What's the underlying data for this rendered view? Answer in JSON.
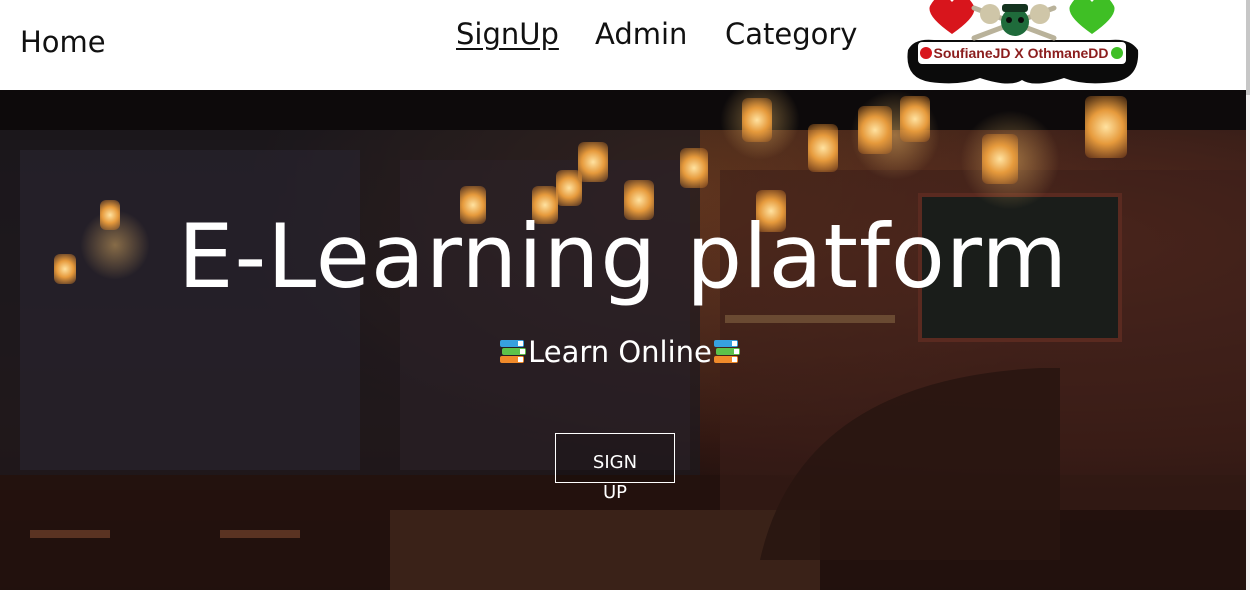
{
  "nav": {
    "home": "Home",
    "signup": "SignUp",
    "admin": "Admin",
    "category": "Category"
  },
  "logo": {
    "text": "SoufianeJD X OthmaneDD"
  },
  "hero": {
    "title": "E-Learning platform",
    "subtitle": "Learn Online",
    "button": "SIGN UP"
  },
  "colors": {
    "navbar_bg": "#ffffff",
    "hero_text": "#ffffff",
    "logo_heart_left": "#d8151c",
    "logo_heart_right": "#3fbf25"
  }
}
